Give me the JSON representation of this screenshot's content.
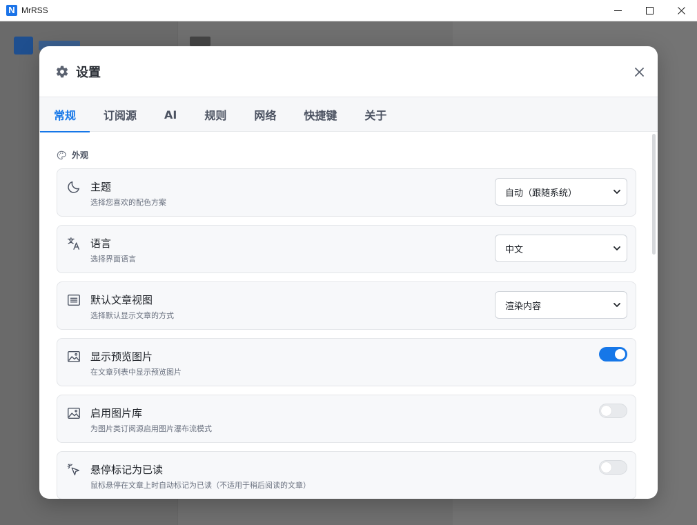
{
  "window": {
    "title": "MrRSS",
    "logo_letter": "N"
  },
  "modal": {
    "title": "设置",
    "tabs": [
      {
        "label": "常规",
        "active": true
      },
      {
        "label": "订阅源",
        "active": false
      },
      {
        "label": "AI",
        "active": false
      },
      {
        "label": "规则",
        "active": false
      },
      {
        "label": "网络",
        "active": false
      },
      {
        "label": "快捷键",
        "active": false
      },
      {
        "label": "关于",
        "active": false
      }
    ],
    "section": {
      "title": "外观",
      "icon": "palette-icon"
    },
    "settings": [
      {
        "icon": "moon-icon",
        "label": "主题",
        "description": "选择您喜欢的配色方案",
        "control": "select",
        "value": "自动（跟随系统）"
      },
      {
        "icon": "translate-icon",
        "label": "语言",
        "description": "选择界面语言",
        "control": "select",
        "value": "中文"
      },
      {
        "icon": "article-icon",
        "label": "默认文章视图",
        "description": "选择默认显示文章的方式",
        "control": "select",
        "value": "渲染内容"
      },
      {
        "icon": "image-icon",
        "label": "显示预览图片",
        "description": "在文章列表中显示预览图片",
        "control": "toggle",
        "value": true
      },
      {
        "icon": "image-icon",
        "label": "启用图片库",
        "description": "为图片类订阅源启用图片瀑布流模式",
        "control": "toggle",
        "value": false
      },
      {
        "icon": "cursor-click-icon",
        "label": "悬停标记为已读",
        "description": "鼠标悬停在文章上时自动标记为已读（不适用于稍后阅读的文章）",
        "control": "toggle",
        "value": false
      }
    ]
  },
  "colors": {
    "accent": "#1677e8",
    "overlay": "#7a7a7a"
  }
}
